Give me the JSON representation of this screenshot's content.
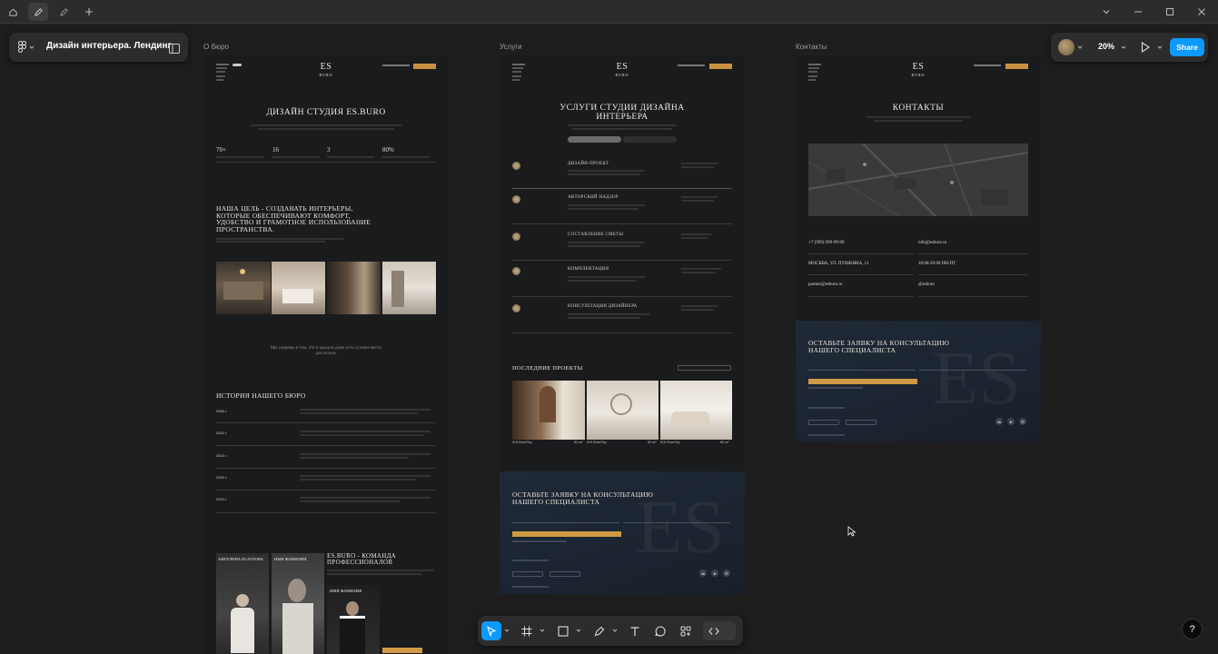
{
  "app": {
    "file_title": "Дизайн интерьера. Лендинг",
    "zoom": "20%",
    "share_label": "Share",
    "help_label": "?"
  },
  "frames": [
    {
      "label": "О бюро",
      "logo_top": "ES",
      "logo_bottom": "BURO",
      "hero_title": "ДИЗАЙН СТУДИЯ ES.BURO",
      "stats": [
        "70+",
        "16",
        "3",
        "80%"
      ],
      "goal_title": "НАША ЦЕЛЬ - СОЗДАВАТЬ ИНТЕРЬЕРЫ, КОТОРЫЕ ОБЕСПЕЧИВАЮТ КОМФОРТ, УДОБСТВО И ГРАМОТНОЕ ИСПОЛЬЗОВАНИЕ ПРОСТРАНСТВА.",
      "quote": "Мы уверены в том, что в каждом доме есть лучшее место для жизни.",
      "history_title": "ИСТОРИЯ НАШЕГО БЮРО",
      "years": [
        "2000 г.",
        "2010 г.",
        "2015 г.",
        "2020 г.",
        "2024 г."
      ],
      "team_title": "ES.BURO - КОМАНДА ПРОФЕССИОНАЛОВ",
      "team_names": [
        "АНГЕЛИНА ЕСАУЛОВА",
        "ИМЯ ФАМИЛИЯ",
        "ИМЯ ФАМИЛИЯ"
      ]
    },
    {
      "label": "Услуги",
      "logo_top": "ES",
      "logo_bottom": "BURO",
      "hero_title": "УСЛУГИ СТУДИИ ДИЗАЙНА ИНТЕРЬЕРА",
      "services": [
        "ДИЗАЙН-ПРОЕКТ",
        "АВТОРСКИЙ НАДЗОР",
        "СОСТАВЛЕНИЕ СМЕТЫ",
        "КОМПЛЕКТАЦИЯ",
        "КОНСУЛЬТАЦИЯ ДИЗАЙНЕРА"
      ],
      "projects_title": "ПОСЛЕДНИЕ ПРОЕКТЫ",
      "project_captions": [
        "ЖК BlueSky",
        "ЖК BlueSky",
        "ЖК BlueSky"
      ],
      "project_areas": [
        "80 м²",
        "80 м²",
        "80 м²"
      ],
      "cta_title": "ОСТАВЬТЕ ЗАЯВКУ НА КОНСУЛЬТАЦИЮ НАШЕГО СПЕЦИАЛИСТА"
    },
    {
      "label": "Контакты",
      "logo_top": "ES",
      "logo_bottom": "BURO",
      "hero_title": "КОНТАКТЫ",
      "phone": "+7 (999) 999-99-99",
      "email": "info@esburo.ru",
      "address": "МОСКВА, УЛ. ПУШКИНА, 11",
      "hours": "10:00-20:00 ПН-ПТ",
      "partner_email": "partner@esburo.ru",
      "handle": "@esburo",
      "cta_title": "ОСТАВЬТЕ ЗАЯВКУ НА КОНСУЛЬТАЦИЮ НАШЕГО СПЕЦИАЛИСТА"
    }
  ],
  "colors": {
    "accent_blue": "#0d99ff",
    "site_orange": "#d09a44",
    "canvas_bg": "#1e1e1e"
  }
}
